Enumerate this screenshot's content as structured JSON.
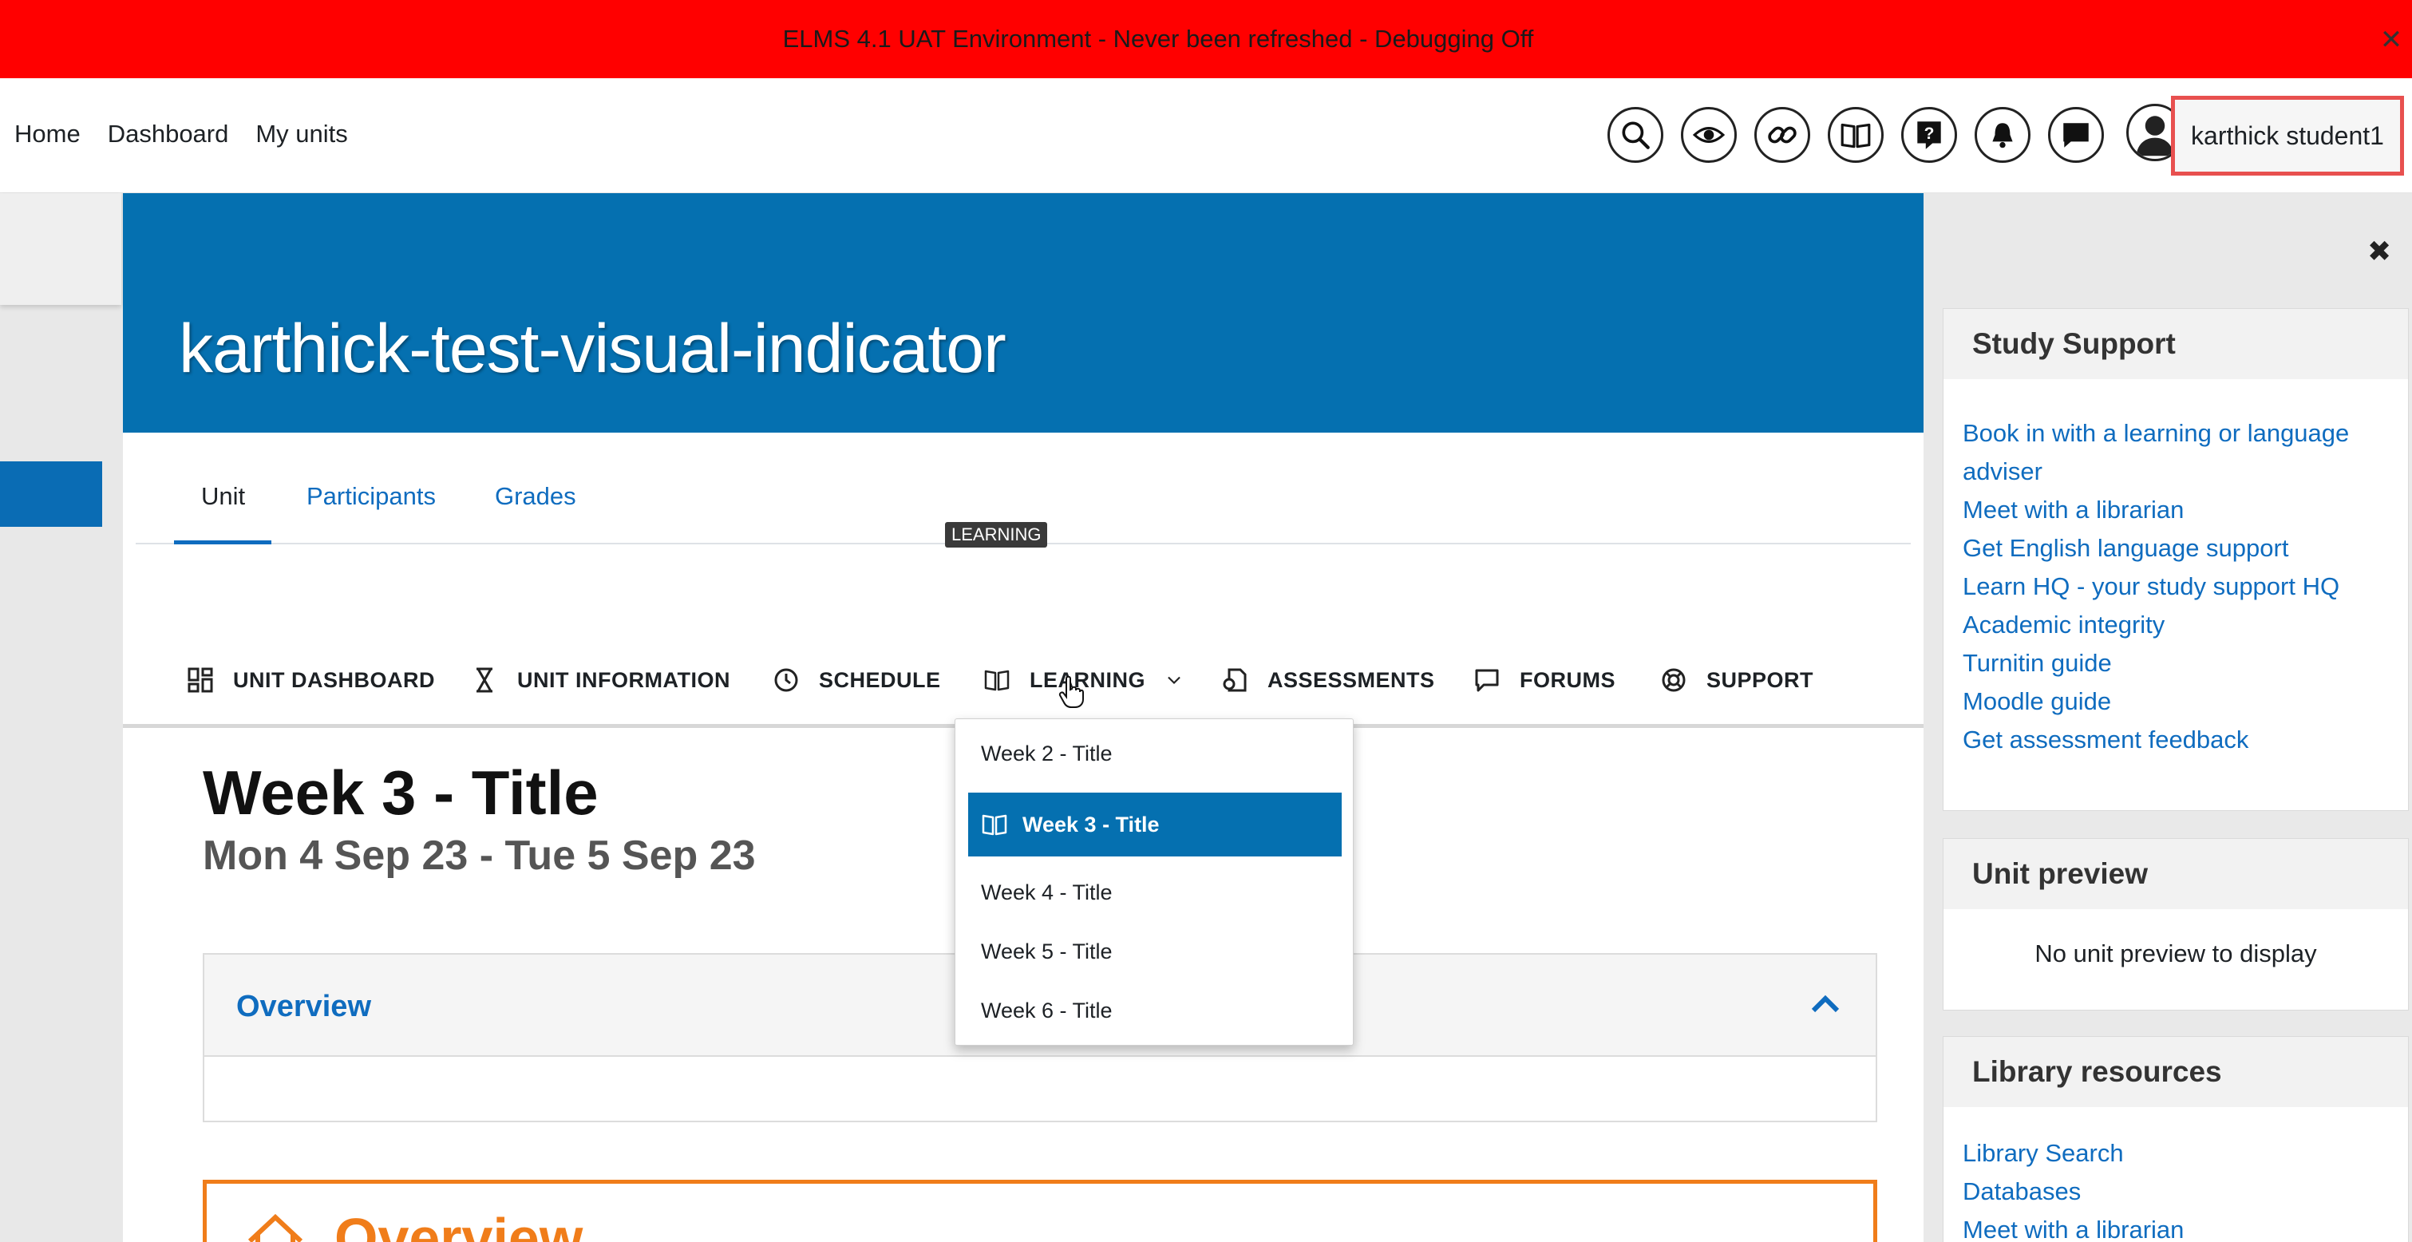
{
  "banner": {
    "text": "ELMS 4.1 UAT Environment - Never been refreshed - Debugging Off",
    "close": "✕"
  },
  "nav": {
    "links": [
      "Home",
      "Dashboard",
      "My units"
    ],
    "icons": [
      "search-icon",
      "visibility-icon",
      "link-icon",
      "book-icon",
      "help-icon",
      "bell-icon",
      "chat-icon"
    ],
    "username": "karthick student1"
  },
  "unit": {
    "title": "karthick-test-visual-indicator",
    "tabs": [
      "Unit",
      "Participants",
      "Grades"
    ],
    "active_tab": "Unit"
  },
  "unit_nav": {
    "items": [
      {
        "label": "UNIT DASHBOARD",
        "icon": "dashboard-icon"
      },
      {
        "label": "UNIT INFORMATION",
        "icon": "hourglass-icon"
      },
      {
        "label": "SCHEDULE",
        "icon": "clock-icon"
      },
      {
        "label": "LEARNING",
        "icon": "book-icon"
      },
      {
        "label": "ASSESSMENTS",
        "icon": "assessment-icon"
      },
      {
        "label": "FORUMS",
        "icon": "forum-icon"
      },
      {
        "label": "SUPPORT",
        "icon": "lifebuoy-icon"
      }
    ],
    "tooltip": "LEARNING"
  },
  "dropdown": {
    "items": [
      "Week 2 - Title",
      "Week 3 - Title",
      "Week 4 - Title",
      "Week 5 - Title",
      "Week 6 - Title"
    ],
    "selected": "Week 3 - Title"
  },
  "week": {
    "title": "Week 3 - Title",
    "dates": "Mon 4 Sep 23 - Tue 5 Sep 23",
    "overview": "Overview",
    "next_section_partial": "Overview"
  },
  "drawer": {
    "close": "✖",
    "study_support": {
      "title": "Study Support",
      "links": [
        "Book in with a learning or language adviser",
        "Meet with a librarian",
        "Get English language support",
        "Learn HQ - your study support HQ",
        "Academic integrity",
        "Turnitin guide",
        "Moodle guide",
        "Get assessment feedback"
      ]
    },
    "unit_preview": {
      "title": "Unit preview",
      "empty": "No unit preview to display"
    },
    "library": {
      "title": "Library resources",
      "links": [
        "Library Search",
        "Databases",
        "Meet with a librarian"
      ]
    }
  },
  "colors": {
    "banner": "#ff0000",
    "brand_blue": "#0570b0",
    "link": "#0f6cbf",
    "accent_orange": "#f07d1a",
    "highlight": "#e8504f"
  }
}
